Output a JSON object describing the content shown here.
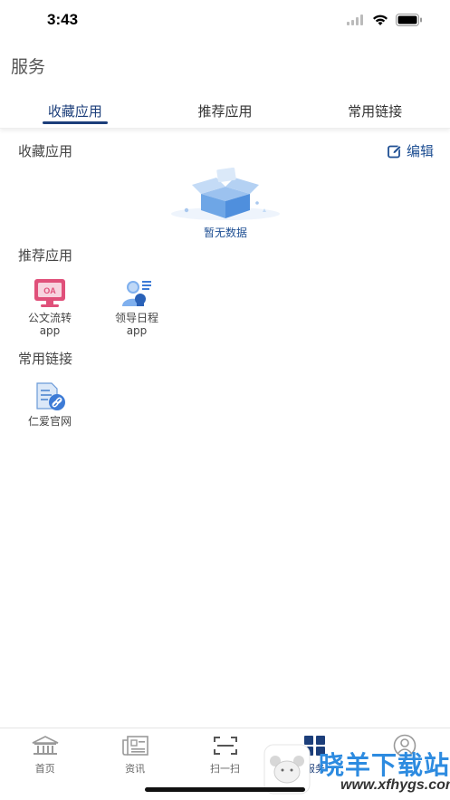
{
  "status_bar": {
    "time": "3:43"
  },
  "page": {
    "title": "服务"
  },
  "tabs": [
    {
      "label": "收藏应用",
      "active": true
    },
    {
      "label": "推荐应用",
      "active": false
    },
    {
      "label": "常用链接",
      "active": false
    }
  ],
  "favorites": {
    "title": "收藏应用",
    "edit_label": "编辑",
    "empty_text": "暂无数据"
  },
  "recommended": {
    "title": "推荐应用",
    "items": [
      {
        "label": "公文流转app",
        "icon": "oa-icon"
      },
      {
        "label": "领导日程app",
        "icon": "leader-schedule-icon"
      }
    ]
  },
  "links": {
    "title": "常用链接",
    "items": [
      {
        "label": "仁爱官网",
        "icon": "website-link-icon"
      }
    ]
  },
  "tabbar": [
    {
      "label": "首页",
      "icon": "home-icon",
      "active": false
    },
    {
      "label": "资讯",
      "icon": "news-icon",
      "active": false
    },
    {
      "label": "扫一扫",
      "icon": "scan-icon",
      "active": false
    },
    {
      "label": "服务",
      "icon": "service-grid-icon",
      "active": true
    },
    {
      "label": "",
      "icon": "profile-icon",
      "active": false
    }
  ],
  "watermark": {
    "text": "晓羊下载站",
    "url": "www.xfhygs.com"
  },
  "colors": {
    "accent": "#1c3e7a",
    "link": "#1e4f93",
    "oa_pink": "#e0507a",
    "icon_blue": "#3d7bd6"
  }
}
